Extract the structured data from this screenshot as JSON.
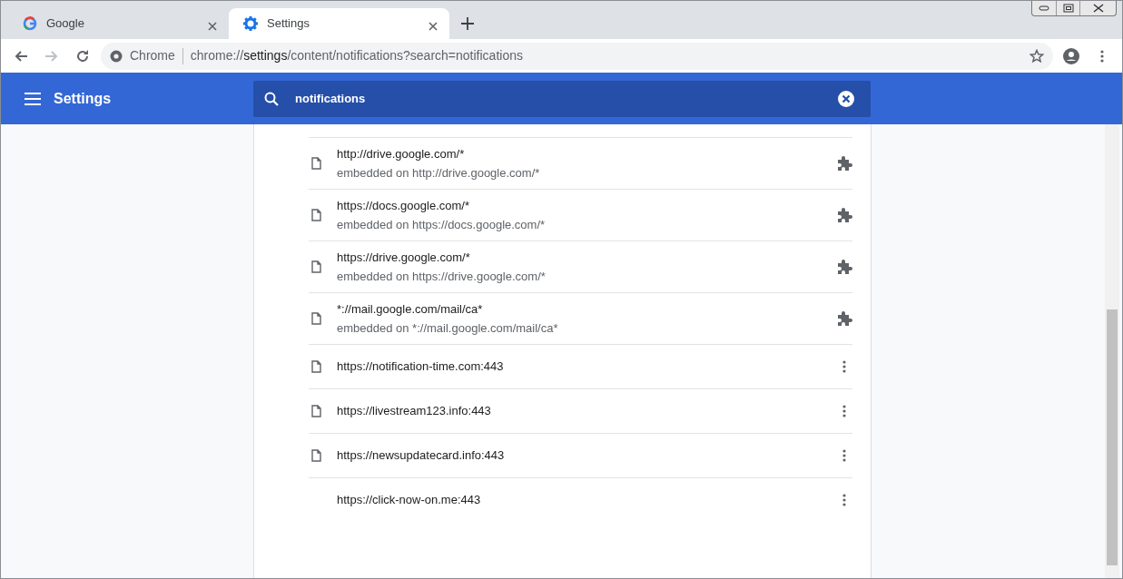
{
  "tabs": [
    {
      "title": "Google",
      "selected": false,
      "kind": "google"
    },
    {
      "title": "Settings",
      "selected": true,
      "kind": "gear"
    }
  ],
  "omnibox": {
    "site_label": "Chrome",
    "url_scheme": "chrome://",
    "url_host": "settings",
    "url_path": "/content/notifications?search=notifications"
  },
  "header": {
    "title": "Settings",
    "search_value": "notifications"
  },
  "rows": [
    {
      "kind": "embedded",
      "page_icon": true,
      "url": "http://drive.google.com/*",
      "detail": "embedded on http://drive.google.com/*"
    },
    {
      "kind": "embedded",
      "page_icon": true,
      "url": "https://docs.google.com/*",
      "detail": "embedded on https://docs.google.com/*"
    },
    {
      "kind": "embedded",
      "page_icon": true,
      "url": "https://drive.google.com/*",
      "detail": "embedded on https://drive.google.com/*"
    },
    {
      "kind": "embedded",
      "page_icon": true,
      "url": "*://mail.google.com/mail/ca*",
      "detail": "embedded on *://mail.google.com/mail/ca*"
    },
    {
      "kind": "site",
      "page_icon": true,
      "url": "https://notification-time.com:443"
    },
    {
      "kind": "site",
      "page_icon": true,
      "url": "https://livestream123.info:443"
    },
    {
      "kind": "site",
      "page_icon": true,
      "url": "https://newsupdatecard.info:443"
    },
    {
      "kind": "site",
      "page_icon": false,
      "url": "https://click-now-on.me:443"
    }
  ]
}
